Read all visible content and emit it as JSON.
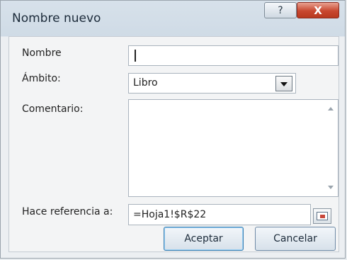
{
  "dialog": {
    "title": "Nombre nuevo",
    "help_glyph": "?",
    "close_glyph": "X"
  },
  "form": {
    "nombre_label": "Nombre",
    "nombre_value": "",
    "ambito_label": "Ámbito:",
    "ambito_value": "Libro",
    "comentario_label": "Comentario:",
    "comentario_value": "",
    "referencia_label": "Hace referencia a:",
    "referencia_value": "=Hoja1!$R$22"
  },
  "buttons": {
    "accept": "Aceptar",
    "cancel": "Cancelar"
  },
  "icons": {
    "help": "help-icon",
    "close": "close-icon",
    "dropdown": "chevron-down-icon",
    "collapse": "collapse-dialog-icon"
  }
}
